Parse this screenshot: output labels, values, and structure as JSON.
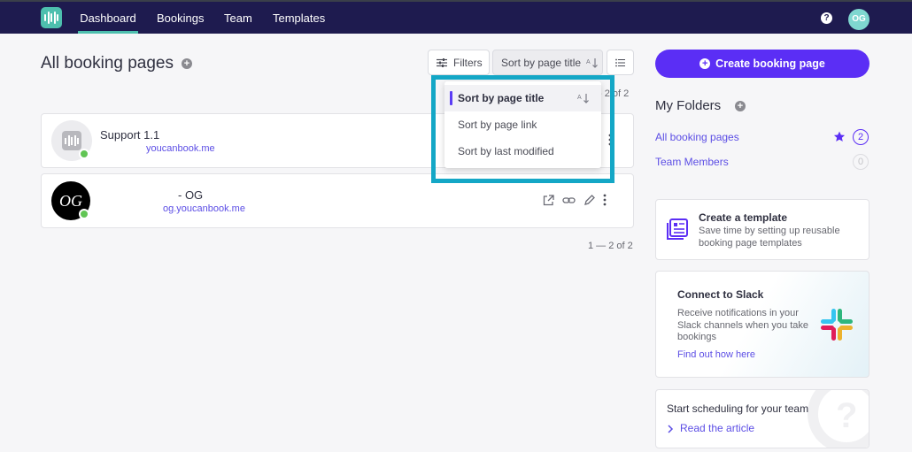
{
  "nav": {
    "items": [
      "Dashboard",
      "Bookings",
      "Team",
      "Templates"
    ],
    "help_label": "?",
    "user_initials": "OG"
  },
  "header": {
    "title": "All booking pages",
    "filters_label": "Filters",
    "sort_label": "Sort by page title"
  },
  "pagination": {
    "top": "- 2 of 2",
    "bottom": "1 — 2 of 2"
  },
  "booking_pages": [
    {
      "title": "Support 1.1",
      "link": "youcanbook.me",
      "status": "active"
    },
    {
      "title": "- OG",
      "link": "og.youcanbook.me",
      "avatar_text": "OG",
      "status": "active"
    }
  ],
  "sort_menu": {
    "options": [
      "Sort by page title",
      "Sort by page link",
      "Sort by last modified"
    ],
    "selected": "Sort by page title"
  },
  "sidebar": {
    "create_button": "Create booking page",
    "folders_title": "My Folders",
    "folders": [
      {
        "label": "All booking pages",
        "count": "2"
      },
      {
        "label": "Team Members",
        "count": "0"
      }
    ],
    "template_card": {
      "title": "Create a template",
      "text": "Save time by setting up reusable booking page templates"
    },
    "slack_card": {
      "title": "Connect to Slack",
      "text": "Receive notifications in your Slack channels when you take bookings",
      "link": "Find out how here"
    },
    "schedule_card": {
      "title": "Start scheduling for your team",
      "link": "Read the article"
    }
  },
  "colors": {
    "nav_bg": "#1e1b4f",
    "accent_teal": "#4dbfae",
    "primary_purple": "#5b2ef5",
    "link_purple": "#5c4ee5",
    "highlight_cyan": "#14a7c6",
    "status_green": "#61c554"
  }
}
